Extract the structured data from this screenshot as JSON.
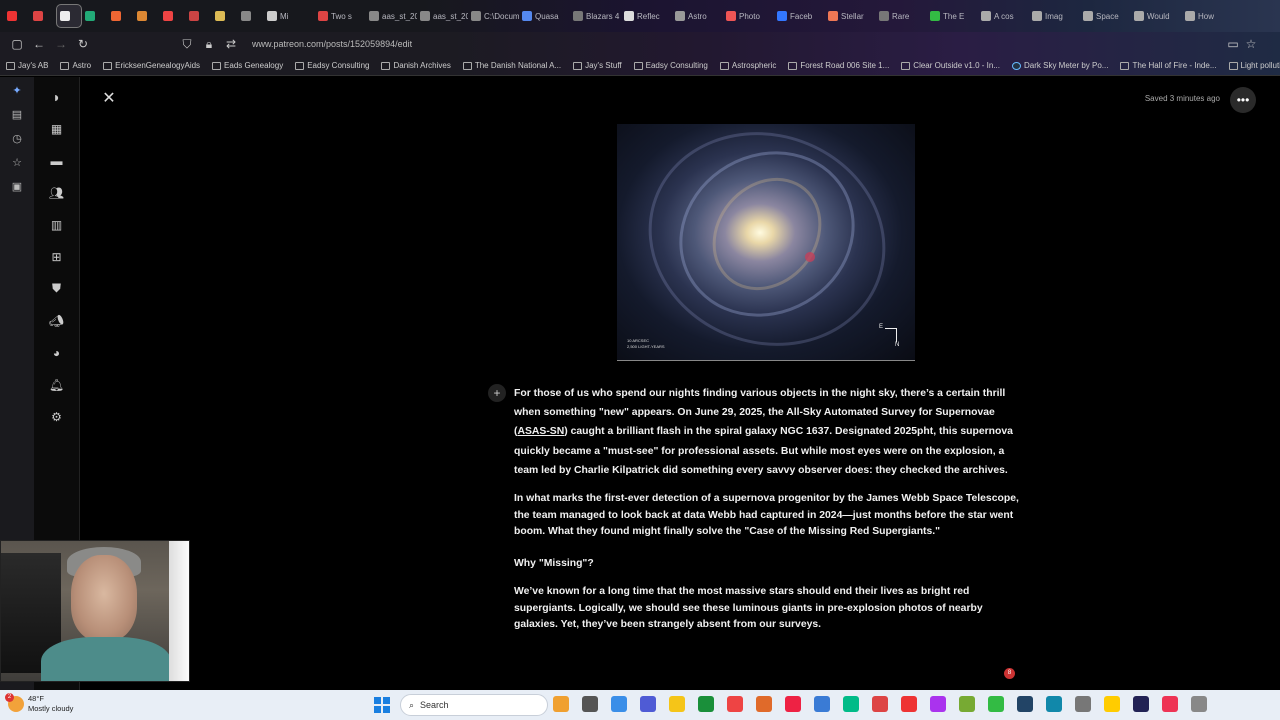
{
  "browser": {
    "tabs": [
      {
        "label": "",
        "color": "#e33"
      },
      {
        "label": "",
        "color": "#d44"
      },
      {
        "label": "",
        "color": "#eee",
        "active": true
      },
      {
        "label": "",
        "color": "#2a7"
      },
      {
        "label": "",
        "color": "#e63"
      },
      {
        "label": "",
        "color": "#d83"
      },
      {
        "label": "",
        "color": "#e44"
      },
      {
        "label": "",
        "color": "#c44"
      },
      {
        "label": "",
        "color": "#db5"
      },
      {
        "label": "",
        "color": "#888"
      },
      {
        "label": "Mi",
        "color": "#ccc",
        "wide": true
      },
      {
        "label": "Two s",
        "color": "#d44",
        "wide": true
      },
      {
        "label": "aas_st_20",
        "color": "#888",
        "wide": true
      },
      {
        "label": "aas_st_20",
        "color": "#888",
        "wide": true
      },
      {
        "label": "C:\\Docum",
        "color": "#888",
        "wide": true
      },
      {
        "label": "Quasa",
        "color": "#58e",
        "wide": true
      },
      {
        "label": "Blazars 4",
        "color": "#777",
        "wide": true
      },
      {
        "label": "Reflec",
        "color": "#ddd",
        "wide": true
      },
      {
        "label": "Astro",
        "color": "#999",
        "wide": true
      },
      {
        "label": "Photo",
        "color": "#e55",
        "wide": true
      },
      {
        "label": "Faceb",
        "color": "#37f",
        "wide": true
      },
      {
        "label": "Stellar",
        "color": "#e75",
        "wide": true
      },
      {
        "label": "Rare",
        "color": "#777",
        "wide": true
      },
      {
        "label": "The E",
        "color": "#3b4",
        "wide": true
      },
      {
        "label": "A cos",
        "color": "#aaa",
        "wide": true
      },
      {
        "label": "Imag",
        "color": "#aaa",
        "wide": true
      },
      {
        "label": "Space",
        "color": "#aaa",
        "wide": true
      },
      {
        "label": "Would",
        "color": "#aaa",
        "wide": true
      },
      {
        "label": "How",
        "color": "#aaa",
        "wide": true
      }
    ],
    "url": "www.patreon.com/posts/152059894/edit",
    "bookmarks": [
      {
        "label": "Jay's AB",
        "type": "fav"
      },
      {
        "label": "Astro",
        "type": "folder"
      },
      {
        "label": "EricksenGenealogyAids",
        "type": "folder"
      },
      {
        "label": "Eads Genealogy",
        "type": "folder"
      },
      {
        "label": "Eadsy Consulting",
        "type": "folder"
      },
      {
        "label": "Danish Archives",
        "type": "fav"
      },
      {
        "label": "The Danish National A...",
        "type": "fav"
      },
      {
        "label": "Jay's Stuff",
        "type": "folder"
      },
      {
        "label": "Eadsy Consulting",
        "type": "folder"
      },
      {
        "label": "Astrospheric",
        "type": "fav"
      },
      {
        "label": "Forest Road 006 Site 1...",
        "type": "fav"
      },
      {
        "label": "Clear Outside v1.0 - In...",
        "type": "fav"
      },
      {
        "label": "Dark Sky Meter by Po...",
        "type": "globe"
      },
      {
        "label": "The Hall of Fire - Inde...",
        "type": "fav"
      },
      {
        "label": "Light pollution map",
        "type": "fav"
      }
    ]
  },
  "editor": {
    "saved_status": "Saved 3 minutes ago",
    "image_scale_line1": "10 ARCSEC",
    "image_scale_line2": "2,500 LIGHT-YEARS",
    "compass_n": "N",
    "compass_e": "E",
    "paragraphs": {
      "p1_a": "For those of us who spend our nights finding various objects in the night sky,  there’s a certain thrill when something \"new\" appears. On June 29, 2025, the All-Sky Automated Survey for Supernovae (",
      "p1_link": "ASAS-SN",
      "p1_b": ") caught a brilliant flash in the spiral galaxy NGC 1637. Designated 2025pht, this supernova quickly became a \"must-see\" for professional assets. But while most eyes were on the explosion, a team led by Charlie Kilpatrick did something every savvy observer does: they checked the archives.",
      "p2": "In what marks the first-ever detection of a supernova progenitor by the James Webb Space Telescope, the team managed to look back at data Webb had captured in 2024—just months before the star went boom. What they found might finally solve the \"Case of the Missing Red Supergiants.\"",
      "p3": "Why \"Missing\"?",
      "p4": "We’ve known for a long time that the most massive stars should end their lives as bright red supergiants. Logically, we should see these luminous giants in pre-explosion photos of nearby galaxies. Yet, they’ve been strangely absent from our surveys."
    },
    "notification_count": "8"
  },
  "taskbar": {
    "weather_temp": "48°F",
    "weather_desc": "Mostly cloudy",
    "weather_badge": "2",
    "search_label": "Search",
    "apps": [
      "#f0a030",
      "#555",
      "#3a8ee8",
      "#4f5bd5",
      "#f5c518",
      "#1a8f3a",
      "#e44",
      "#e06a2a",
      "#e24",
      "#3a7bd5",
      "#0b8",
      "#d44",
      "#e33",
      "#a3e",
      "#7a3",
      "#3b4",
      "#246",
      "#18a",
      "#777",
      "#fc0",
      "#225",
      "#e35",
      "#888"
    ]
  }
}
